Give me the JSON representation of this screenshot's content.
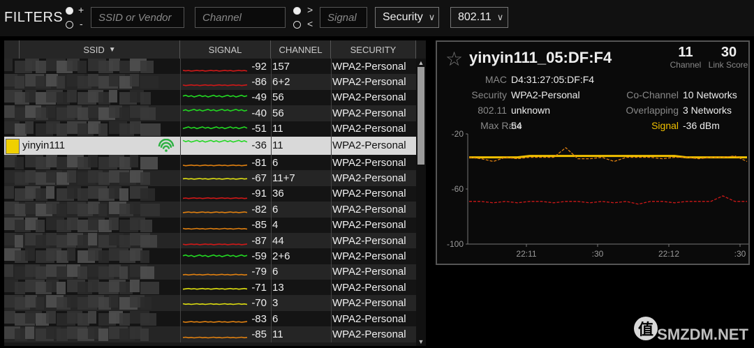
{
  "filters": {
    "title": "FILTERS",
    "radio1_plus": "+",
    "radio1_minus": "-",
    "ssid_placeholder": "SSID or Vendor",
    "channel_placeholder": "Channel",
    "radio2_gt": ">",
    "radio2_lt": "<",
    "signal_placeholder": "Signal",
    "security_select": "Security",
    "standard_select": "802.11"
  },
  "table": {
    "headers": {
      "ssid": "SSID",
      "signal": "SIGNAL",
      "channel": "CHANNEL",
      "security": "SECURITY"
    },
    "rows": [
      {
        "ssid": "",
        "signal": "-92",
        "channel": "157",
        "security": "WPA2-Personal",
        "color": "#d01818"
      },
      {
        "ssid": "",
        "signal": "-86",
        "channel": "6+2",
        "security": "WPA2-Personal",
        "color": "#d01818"
      },
      {
        "ssid": "",
        "signal": "-49",
        "channel": "56",
        "security": "WPA2-Personal",
        "color": "#22d822"
      },
      {
        "ssid": "",
        "signal": "-40",
        "channel": "56",
        "security": "WPA2-Personal",
        "color": "#22d822"
      },
      {
        "ssid": "",
        "signal": "-51",
        "channel": "11",
        "security": "WPA2-Personal",
        "color": "#22d822"
      },
      {
        "ssid": "yinyin111",
        "signal": "-36",
        "channel": "11",
        "security": "WPA2-Personal",
        "color": "#22d822",
        "selected": true
      },
      {
        "ssid": "",
        "signal": "-81",
        "channel": "6",
        "security": "WPA2-Personal",
        "color": "#e08010"
      },
      {
        "ssid": "",
        "signal": "-67",
        "channel": "11+7",
        "security": "WPA2-Personal",
        "color": "#e0e010"
      },
      {
        "ssid": "",
        "signal": "-91",
        "channel": "36",
        "security": "WPA2-Personal",
        "color": "#d01818"
      },
      {
        "ssid": "",
        "signal": "-82",
        "channel": "6",
        "security": "WPA2-Personal",
        "color": "#e08010"
      },
      {
        "ssid": "",
        "signal": "-85",
        "channel": "4",
        "security": "WPA2-Personal",
        "color": "#e08010"
      },
      {
        "ssid": "",
        "signal": "-87",
        "channel": "44",
        "security": "WPA2-Personal",
        "color": "#d01818"
      },
      {
        "ssid": "",
        "signal": "-59",
        "channel": "2+6",
        "security": "WPA2-Personal",
        "color": "#22d822"
      },
      {
        "ssid": "",
        "signal": "-79",
        "channel": "6",
        "security": "WPA2-Personal",
        "color": "#e08010"
      },
      {
        "ssid": "",
        "signal": "-71",
        "channel": "13",
        "security": "WPA2-Personal",
        "color": "#e0e010"
      },
      {
        "ssid": "",
        "signal": "-70",
        "channel": "3",
        "security": "WPA2-Personal",
        "color": "#e0e010"
      },
      {
        "ssid": "",
        "signal": "-83",
        "channel": "6",
        "security": "WPA2-Personal",
        "color": "#e08010"
      },
      {
        "ssid": "",
        "signal": "-85",
        "channel": "11",
        "security": "WPA2-Personal",
        "color": "#e08010"
      }
    ]
  },
  "detail": {
    "name": "yinyin111_05:DF:F4",
    "channel_num": "11",
    "channel_cap": "Channel",
    "link_score_num": "30",
    "link_score_cap": "Link Score",
    "mac_label": "MAC",
    "mac_value": "D4:31:27:05:DF:F4",
    "security_label": "Security",
    "security_value": "WPA2-Personal",
    "standard_label": "802.11",
    "standard_value": "unknown",
    "maxrate_label": "Max Rate",
    "maxrate_value": "54",
    "cochannel_label": "Co-Channel",
    "cochannel_value": "10 Networks",
    "overlap_label": "Overlapping",
    "overlap_value": "3 Networks",
    "signal_label": "Signal",
    "signal_value": "-36 dBm",
    "accent": "#f0c000"
  },
  "chart_data": {
    "type": "line",
    "yticks": [
      "-20",
      "-60",
      "-100"
    ],
    "ylim": [
      -100,
      -20
    ],
    "xticks": [
      "22:11",
      ":30",
      "22:12",
      ":30"
    ],
    "series": [
      {
        "values": [
          -37,
          -37,
          -37,
          -37,
          -37,
          -36,
          -36,
          -36,
          -36,
          -36,
          -36,
          -36,
          -36,
          -36,
          -36,
          -36,
          -36,
          -36,
          -37,
          -37,
          -37,
          -37,
          -37,
          -37
        ],
        "color": "#f0c000"
      },
      {
        "values": [
          -37,
          -38,
          -40,
          -37,
          -38,
          -37,
          -37,
          -37,
          -30,
          -38,
          -38,
          -37,
          -40,
          -37,
          -37,
          -37,
          -38,
          -37,
          -37,
          -38,
          -37,
          -37,
          -36,
          -40
        ],
        "color": "#e08010"
      },
      {
        "values": [
          -69,
          -69,
          -70,
          -69,
          -70,
          -69,
          -69,
          -70,
          -69,
          -69,
          -70,
          -69,
          -70,
          -69,
          -71,
          -69,
          -69,
          -70,
          -69,
          -69,
          -69,
          -65,
          -69,
          -69
        ],
        "color": "#d01818"
      }
    ]
  },
  "watermark": {
    "logo": "值",
    "text": "SMZDM.NET"
  }
}
